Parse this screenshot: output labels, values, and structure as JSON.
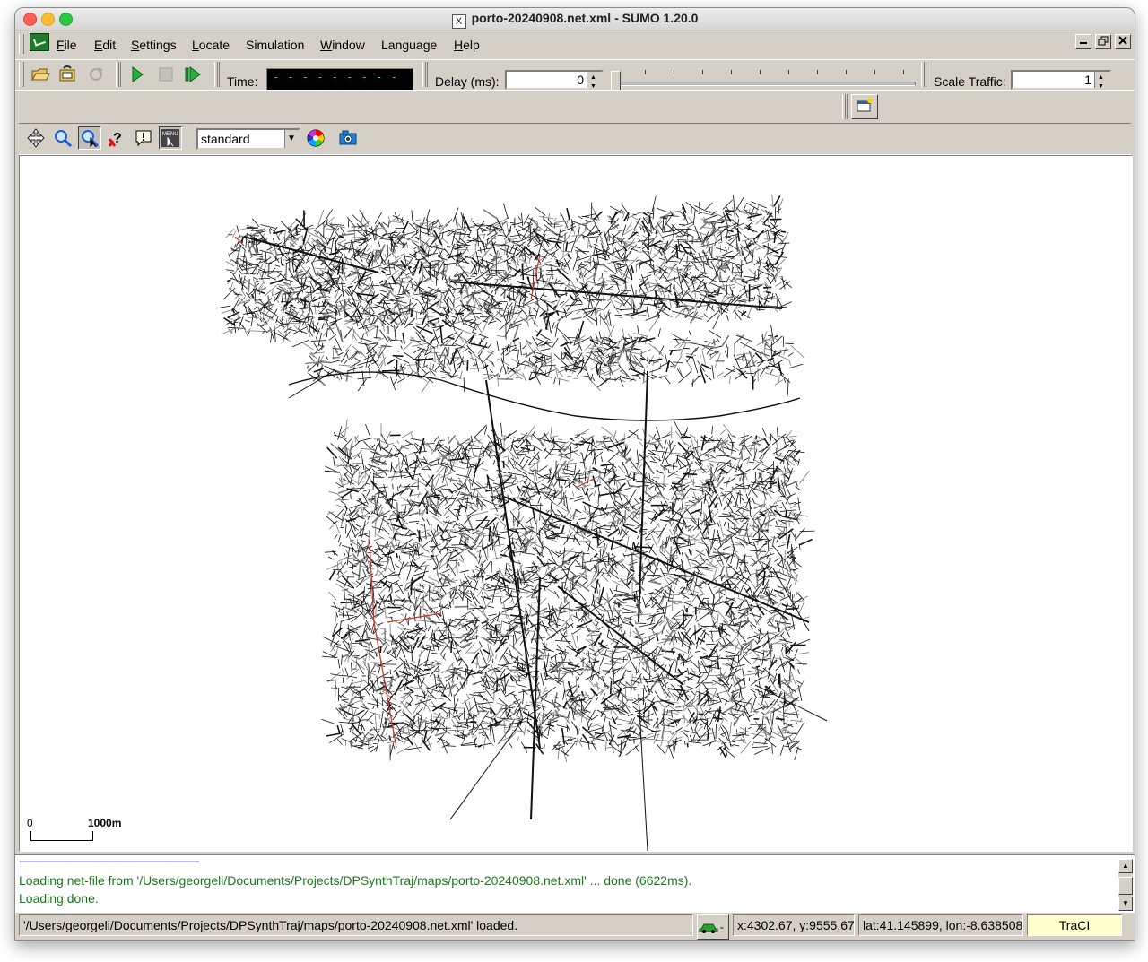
{
  "window": {
    "title": "porto-20240908.net.xml - SUMO 1.20.0",
    "x11_icon": "X"
  },
  "menu": {
    "items": [
      "File",
      "Edit",
      "Settings",
      "Locate",
      "Simulation",
      "Window",
      "Language",
      "Help"
    ],
    "mnemonics": [
      "F",
      "E",
      "S",
      "L",
      "",
      "W",
      "",
      "H"
    ],
    "rest": [
      "ile",
      "dit",
      "ettings",
      "ocate",
      "Simulation",
      "indow",
      "Language",
      "elp"
    ],
    "mdi_buttons": [
      "minimize-icon",
      "restore-icon",
      "close-icon"
    ]
  },
  "toolbar": {
    "time_label": "Time:",
    "time_value": "- - - - - - - - - - - - - - -",
    "delay_label": "Delay (ms):",
    "delay_value": "0",
    "scale_label": "Scale Traffic:",
    "scale_value": "1",
    "icons": [
      "open-folder-icon",
      "reload-network-icon",
      "reload-icon",
      "run-icon",
      "stop-icon",
      "step-icon"
    ]
  },
  "viewbar": {
    "icons": [
      "recenter-view-icon",
      "locate-icon",
      "zoom-lock-icon",
      "query-icon",
      "tooltip-icon",
      "selection-menu-icon",
      "color-wheel-icon",
      "screenshot-camera-icon"
    ],
    "scheme": "standard"
  },
  "canvas": {
    "scale_zero": "0",
    "scale_max": "1000m"
  },
  "messages": {
    "separator": "--------------------------------------------------------------------------------------",
    "lines": [
      "Loading net-file from '/Users/georgeli/Documents/Projects/DPSynthTraj/maps/porto-20240908.net.xml' ... done (6622ms).",
      "Loading done."
    ]
  },
  "status": {
    "message": "'/Users/georgeli/Documents/Projects/DPSynthTraj/maps/porto-20240908.net.xml' loaded.",
    "car_label": "-",
    "xy": "x:4302.67, y:9555.67",
    "latlon": "lat:41.145899, lon:-8.638508",
    "traci": "TraCI"
  },
  "colors": {
    "time_text": "#00ff00",
    "message_text": "#1a7a1a",
    "traci_bg": "#ffffcc",
    "network_road": "#111111",
    "network_highlight": "#cc3322"
  }
}
